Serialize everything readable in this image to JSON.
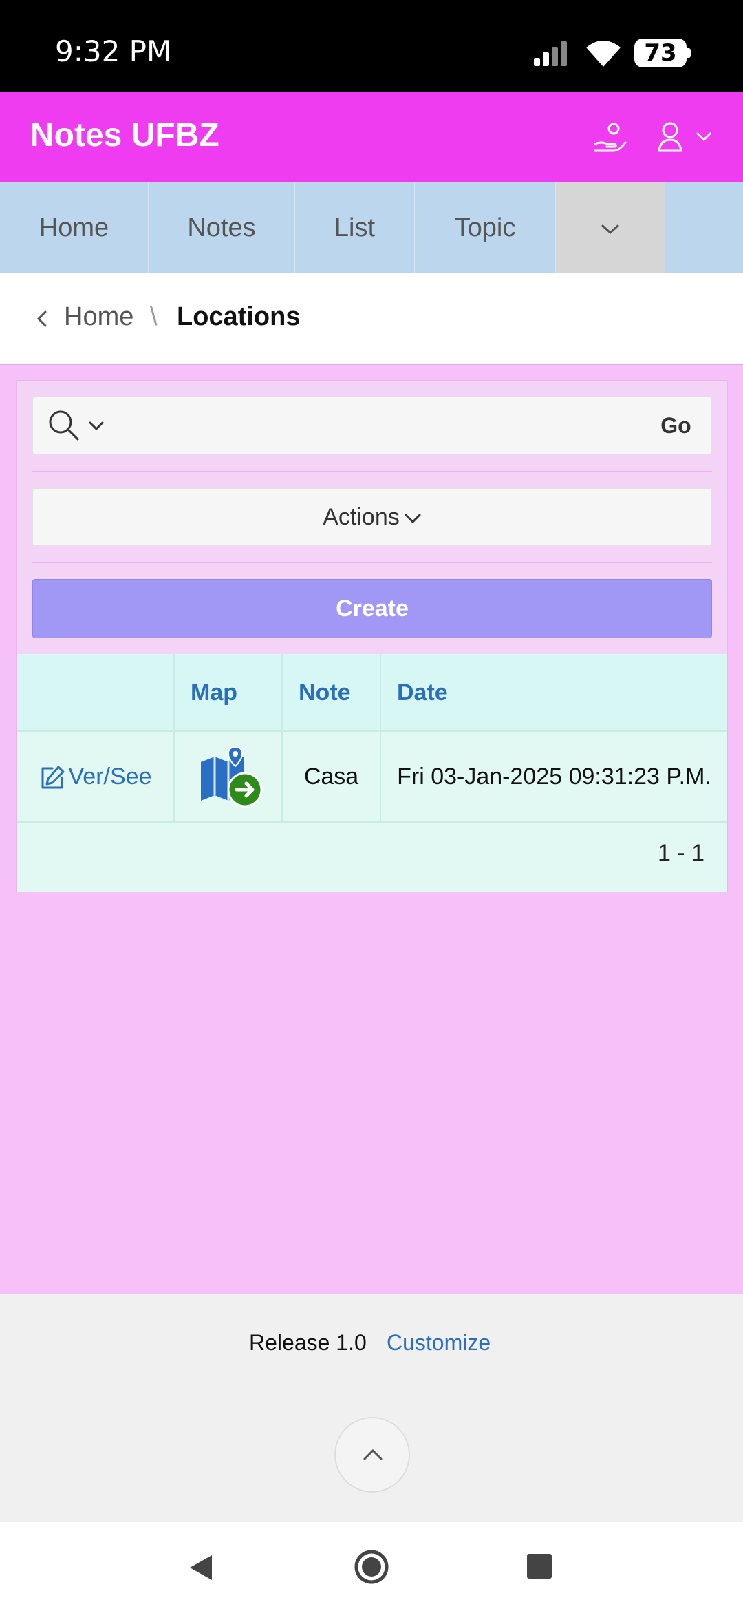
{
  "status_bar": {
    "time": "9:32 PM",
    "battery": "73"
  },
  "app": {
    "title": "Notes UFBZ"
  },
  "nav": {
    "tabs": [
      {
        "label": "Home"
      },
      {
        "label": "Notes"
      },
      {
        "label": "List"
      },
      {
        "label": "Topic"
      }
    ]
  },
  "breadcrumb": {
    "parent": "Home",
    "separator": "\\",
    "current": "Locations"
  },
  "search": {
    "value": "",
    "placeholder": "",
    "go_label": "Go"
  },
  "toolbar": {
    "actions_label": "Actions",
    "create_label": "Create"
  },
  "table": {
    "headers": {
      "edit": "",
      "map": "Map",
      "note": "Note",
      "date": "Date"
    },
    "rows": [
      {
        "edit": "Ver/See",
        "note": "Casa",
        "date": "Fri 03-Jan-2025 09:31:23 P.M."
      }
    ],
    "pagination": "1 - 1"
  },
  "footer": {
    "release": "Release 1.0",
    "customize": "Customize"
  },
  "colors": {
    "header": "#ef3cf0",
    "nav": "#bcd6ee",
    "background": "#f6c0f8",
    "create_button": "#a198f6",
    "link": "#2a6fba",
    "table": "#e2f8f2"
  }
}
